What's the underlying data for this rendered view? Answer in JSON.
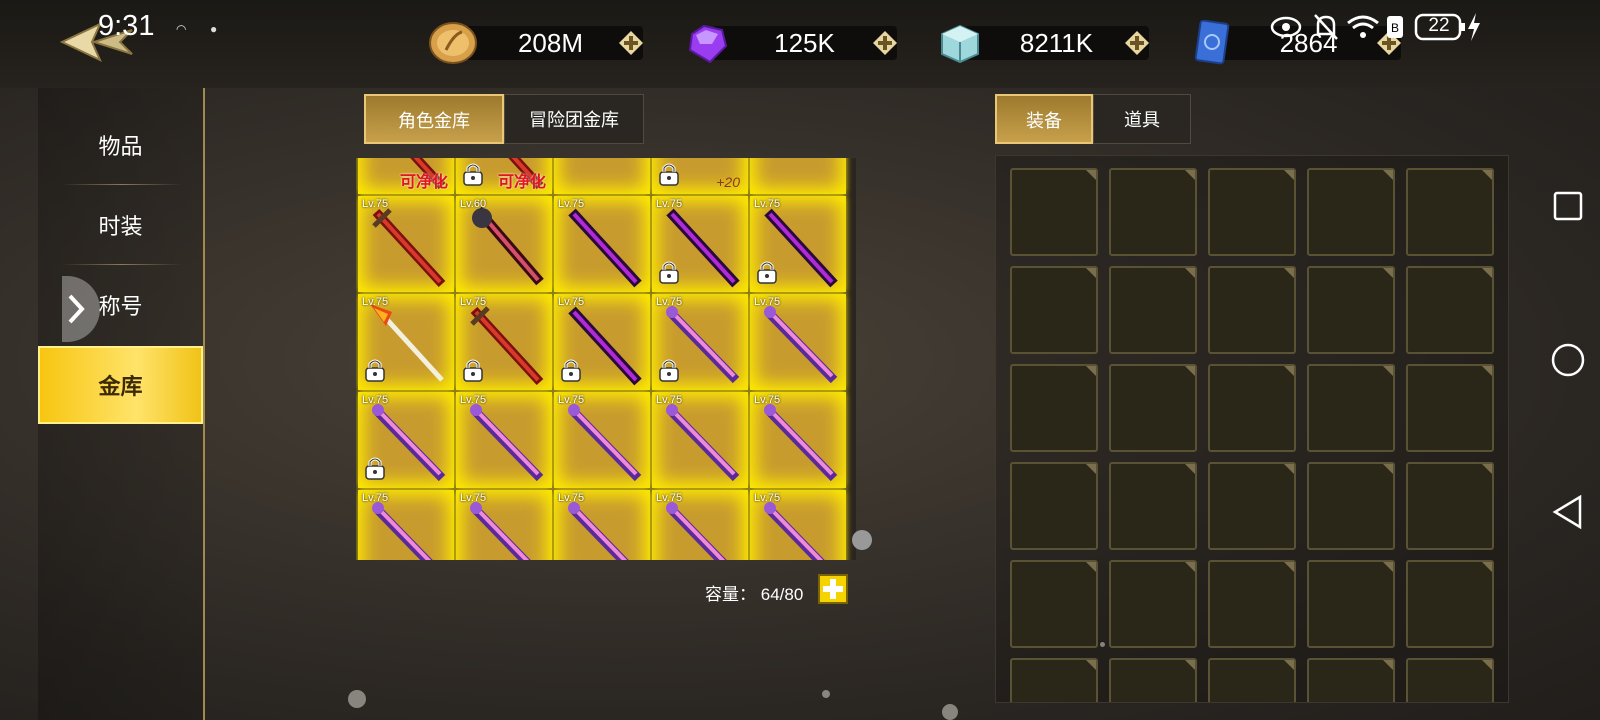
{
  "status_bar": {
    "time": "9:31",
    "battery": "22"
  },
  "currencies": [
    {
      "name": "gold",
      "value": "208M",
      "icon": "gold-coin-icon"
    },
    {
      "name": "gem",
      "value": "125K",
      "icon": "purple-gem-icon"
    },
    {
      "name": "cube",
      "value": "8211K",
      "icon": "ice-cube-icon"
    },
    {
      "name": "card",
      "value": "2864",
      "icon": "blue-card-icon"
    }
  ],
  "sidebar": {
    "items": [
      {
        "label": "物品"
      },
      {
        "label": "时装"
      },
      {
        "label": "称号"
      },
      {
        "label": "金库",
        "active": true
      }
    ]
  },
  "vault_tabs": [
    {
      "label": "角色金库",
      "active": true
    },
    {
      "label": "冒险团金库",
      "active": false
    }
  ],
  "inventory_tabs": [
    {
      "label": "装备",
      "active": true
    },
    {
      "label": "道具",
      "active": false
    }
  ],
  "vault_items": [
    {
      "level": "",
      "tag": "可净化",
      "locked": false,
      "weapon": "red-sword"
    },
    {
      "level": "",
      "tag": "可净化",
      "locked": true,
      "weapon": "red-sword"
    },
    {
      "level": "",
      "tag": "",
      "locked": false,
      "weapon": "dark-sword"
    },
    {
      "level": "",
      "tag": "+20",
      "locked": true,
      "weapon": "purple-scythe"
    },
    {
      "level": "",
      "tag": "",
      "locked": false,
      "weapon": "white-bow"
    },
    {
      "level": "Lv.75",
      "tag": "",
      "locked": false,
      "weapon": "red-sword"
    },
    {
      "level": "Lv.60",
      "tag": "",
      "locked": false,
      "weapon": "dark-red-sword"
    },
    {
      "level": "Lv.75",
      "tag": "",
      "locked": false,
      "weapon": "purple-sword"
    },
    {
      "level": "Lv.75",
      "tag": "",
      "locked": true,
      "weapon": "purple-sword"
    },
    {
      "level": "Lv.75",
      "tag": "",
      "locked": true,
      "weapon": "purple-sword"
    },
    {
      "level": "Lv.75",
      "tag": "",
      "locked": true,
      "weapon": "flame-spear"
    },
    {
      "level": "Lv.75",
      "tag": "",
      "locked": true,
      "weapon": "red-sword"
    },
    {
      "level": "Lv.75",
      "tag": "",
      "locked": true,
      "weapon": "purple-sword"
    },
    {
      "level": "Lv.75",
      "tag": "",
      "locked": true,
      "weapon": "pink-blade"
    },
    {
      "level": "Lv.75",
      "tag": "",
      "locked": false,
      "weapon": "pink-blade"
    },
    {
      "level": "Lv.75",
      "tag": "",
      "locked": true,
      "weapon": "pink-blade"
    },
    {
      "level": "Lv.75",
      "tag": "",
      "locked": false,
      "weapon": "pink-blade"
    },
    {
      "level": "Lv.75",
      "tag": "",
      "locked": false,
      "weapon": "pink-blade"
    },
    {
      "level": "Lv.75",
      "tag": "",
      "locked": false,
      "weapon": "pink-blade"
    },
    {
      "level": "Lv.75",
      "tag": "",
      "locked": false,
      "weapon": "pink-blade"
    },
    {
      "level": "Lv.75",
      "tag": "",
      "locked": false,
      "weapon": "pink-blade"
    },
    {
      "level": "Lv.75",
      "tag": "",
      "locked": false,
      "weapon": "pink-blade"
    },
    {
      "level": "Lv.75",
      "tag": "",
      "locked": false,
      "weapon": "pink-blade"
    },
    {
      "level": "Lv.75",
      "tag": "",
      "locked": false,
      "weapon": "pink-blade"
    },
    {
      "level": "Lv.75",
      "tag": "",
      "locked": false,
      "weapon": "pink-blade"
    }
  ],
  "capacity": {
    "label": "容量：",
    "value": "64/80"
  },
  "inventory_slots": 30,
  "colors": {
    "gold_accent": "#f7c611",
    "item_glow": "#ffec00",
    "panel_bg": "#2a2622"
  }
}
